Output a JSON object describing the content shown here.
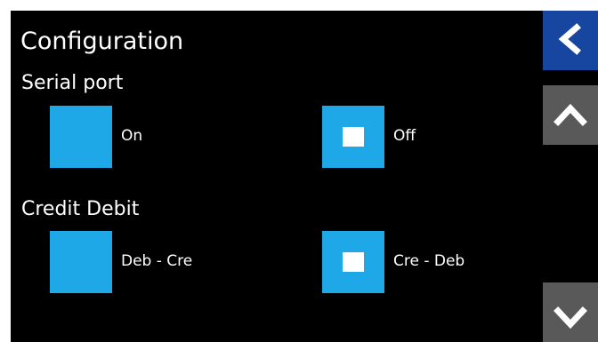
{
  "screen": {
    "title": "Configuration"
  },
  "serial_port": {
    "label": "Serial port",
    "options": [
      {
        "label": "On",
        "selected": false
      },
      {
        "label": "Off",
        "selected": true
      }
    ]
  },
  "credit_debit": {
    "label": "Credit Debit",
    "options": [
      {
        "label": "Deb - Cre",
        "selected": false
      },
      {
        "label": "Cre - Deb",
        "selected": true
      }
    ]
  },
  "nav": {
    "back_icon": "chevron-left-icon",
    "up_icon": "chevron-up-icon",
    "down_icon": "chevron-down-icon"
  },
  "colors": {
    "background": "#000000",
    "option_box": "#1ea8e8",
    "back_button": "#1646a0",
    "scroll_buttons": "#595959",
    "text": "#ffffff"
  }
}
